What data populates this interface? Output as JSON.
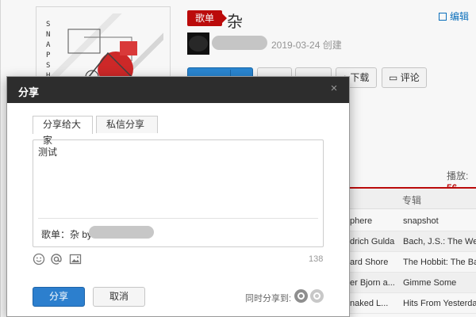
{
  "background": {
    "tag_label": "歌单",
    "playlist_title": "杂",
    "edit_label": "编辑",
    "created_text": "2019-03-24 创建",
    "cover_letters": "SNAPSHOT",
    "actions": {
      "download_label": "下载",
      "comment_label": "评论"
    },
    "plays_label": "播放:",
    "plays_value": "56",
    "table": {
      "album_header": "专辑",
      "rows": [
        {
          "artist": "phere",
          "album": "snapshot"
        },
        {
          "artist": "drich Gulda",
          "album": "Bach, J.S.: The Well-"
        },
        {
          "artist": "ard Shore",
          "album": "The Hobbit: The Battl"
        },
        {
          "artist": "er Bjorn a...",
          "album": "Gimme Some"
        },
        {
          "artist": "naked L...",
          "album": "Hits From Yesterday"
        }
      ]
    }
  },
  "dialog": {
    "title": "分享",
    "close_glyph": "×",
    "tabs": [
      {
        "label": "分享给大家",
        "active": true
      },
      {
        "label": "私信分享",
        "active": false
      }
    ],
    "editor": {
      "text": "测试",
      "reference": "歌单：杂 by"
    },
    "tools": [
      "emoji-icon",
      "at-icon",
      "image-icon"
    ],
    "char_count": "138",
    "share_button": "分享",
    "cancel_button": "取消",
    "sync_label": "同时分享到:",
    "sync_targets": [
      "weibo-icon",
      "douban-icon"
    ]
  },
  "colors": {
    "brand_red": "#c20c0c",
    "primary_blue": "#2c7fce",
    "dialog_header": "#2d2d2d"
  }
}
